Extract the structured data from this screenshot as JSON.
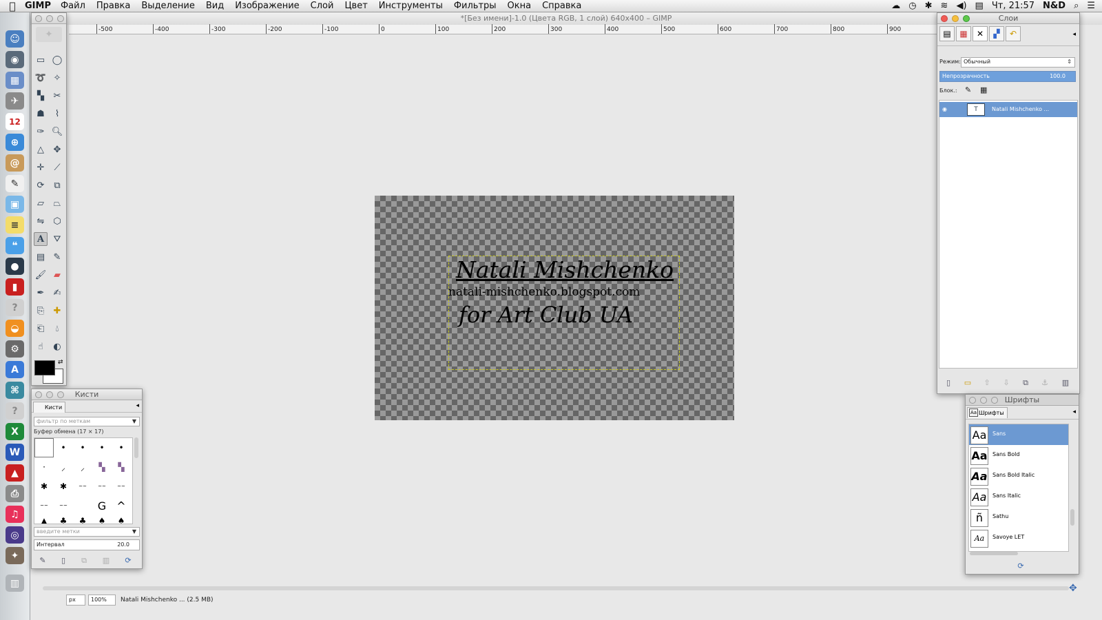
{
  "menubar": {
    "app": "GIMP",
    "items": [
      "Файл",
      "Правка",
      "Выделение",
      "Вид",
      "Изображение",
      "Слой",
      "Цвет",
      "Инструменты",
      "Фильтры",
      "Окна",
      "Справка"
    ],
    "clock": "Чт, 21:57",
    "user": "N&D"
  },
  "image_window": {
    "title": "*[Без имени]-1.0 (Цвета RGB, 1 слой) 640x400 – GIMP",
    "ruler_labels": [
      "-500",
      "-400",
      "-300",
      "-200",
      "-100",
      "0",
      "100",
      "200",
      "300",
      "400",
      "500",
      "600",
      "700",
      "800",
      "900"
    ],
    "canvas_text": {
      "line1": "Natali Mishchenko",
      "line2": "natali-mishchenko.blogspot.com",
      "line3": "for Art Club UA"
    },
    "status": {
      "unit": "px",
      "zoom": "100%",
      "info": "Natali Mishchenko ... (2.5 MB)"
    }
  },
  "brushes": {
    "title": "Кисти",
    "tab": "Кисти",
    "filter_placeholder": "фильтр по меткам",
    "brush_name": "Буфер обмена (17 × 17)",
    "tags_placeholder": "введите метки",
    "spacing_label": "Интервал",
    "spacing_value": "20.0"
  },
  "layers": {
    "title": "Слои",
    "mode_label": "Режим:",
    "mode_value": "Обычный",
    "opacity_label": "Непрозрачность",
    "opacity_value": "100.0",
    "lock_label": "Блок.:",
    "layer_name": "Natali Mishchenko ..."
  },
  "fonts": {
    "title": "Шрифты",
    "tab": "Шрифты",
    "items": [
      {
        "glyph": "Aa",
        "name": "Sans"
      },
      {
        "glyph": "Aa",
        "name": "Sans Bold"
      },
      {
        "glyph": "Aa",
        "name": "Sans Bold Italic"
      },
      {
        "glyph": "Aa",
        "name": "Sans Italic"
      },
      {
        "glyph": "ñ",
        "name": "Sathu"
      },
      {
        "glyph": "Aa",
        "name": "Savoye LET"
      }
    ],
    "selected_index": 0
  },
  "colors": {
    "selection": "#6c99d2",
    "foreground": "#000000",
    "background": "#ffffff"
  }
}
